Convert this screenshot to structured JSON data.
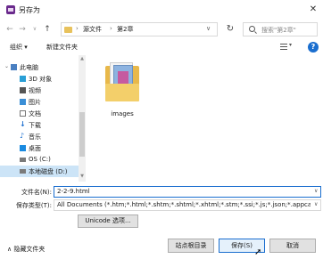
{
  "window": {
    "title": "另存为",
    "close_glyph": "✕"
  },
  "address_bar": {
    "back": "←",
    "forward": "→",
    "recent": "∨",
    "up": "↑",
    "breadcrumb": [
      "源文件",
      "第2章"
    ],
    "separator": "›",
    "dropdown": "∨",
    "refresh": "↻"
  },
  "search": {
    "placeholder": "搜索\"第2章\""
  },
  "toolbar": {
    "organize": "组织 ▾",
    "new_folder": "新建文件夹",
    "view_caret": "▾",
    "help": "?"
  },
  "nav_pane": {
    "items": [
      {
        "label": "此电脑",
        "icon": "computer-icon",
        "color": "#4a7fc1"
      },
      {
        "label": "3D 对象",
        "icon": "3d-objects-icon",
        "color": "#2a9fd6"
      },
      {
        "label": "视频",
        "icon": "video-icon",
        "color": "#555555"
      },
      {
        "label": "图片",
        "icon": "pictures-icon",
        "color": "#3a8ed6"
      },
      {
        "label": "文档",
        "icon": "documents-icon",
        "color": "#777777"
      },
      {
        "label": "下载",
        "icon": "download-icon",
        "color": "#1a6ecf"
      },
      {
        "label": "音乐",
        "icon": "music-icon",
        "color": "#1a6ecf"
      },
      {
        "label": "桌面",
        "icon": "desktop-icon",
        "color": "#1a8ae0"
      },
      {
        "label": "OS (C:)",
        "icon": "drive-icon",
        "color": "#7a7a7a"
      },
      {
        "label": "本地磁盘 (D:)",
        "icon": "drive-icon",
        "color": "#7a7a7a"
      }
    ],
    "scroll_up": "▲",
    "scroll_down": "▼"
  },
  "files": [
    {
      "name": "images",
      "icon": "folder-icon"
    }
  ],
  "form": {
    "filename_label": "文件名(N):",
    "filename_value": "2-2-9.html",
    "filetype_label": "保存类型(T):",
    "filetype_value": "All Documents (*.htm;*.html;*.shtm;*.shtml;*.xhtml;*.stm;*.ssi;*.js;*.json;*.appcache",
    "caret": "∨",
    "unicode_button": "Unicode 选项..."
  },
  "footer": {
    "hide_folders": "∧ 隐藏文件夹",
    "site_root": "站点根目录",
    "save": "保存(S)",
    "cancel": "取消"
  },
  "colors": {
    "accent": "#1a6ecf",
    "selected_bg": "#cce4f7",
    "folder": "#e8b84a"
  }
}
